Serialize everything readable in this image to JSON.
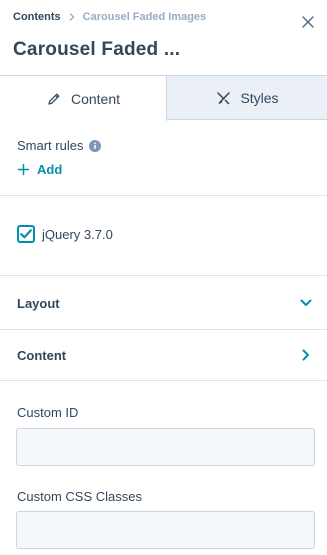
{
  "header": {
    "breadcrumb": {
      "parent": "Contents",
      "current": "Carousel Faded Images"
    },
    "title": "Carousel Faded ..."
  },
  "tabs": [
    {
      "label": "Content",
      "icon": "pencil-icon",
      "active": true
    },
    {
      "label": "Styles",
      "icon": "paint-brush-icon",
      "active": false
    }
  ],
  "smart_rules": {
    "label": "Smart rules",
    "add_label": "Add"
  },
  "dependencies": {
    "jquery": {
      "label": "jQuery 3.7.0",
      "checked": true
    }
  },
  "accordions": {
    "layout": {
      "title": "Layout",
      "icon": "chevron-down-icon"
    },
    "content": {
      "title": "Content",
      "icon": "chevron-right-icon"
    }
  },
  "fields": {
    "custom_id": {
      "label": "Custom ID",
      "value": ""
    },
    "custom_css": {
      "label": "Custom CSS Classes",
      "value": ""
    }
  },
  "colors": {
    "accent": "#0091ae",
    "text": "#33475b",
    "muted": "#99acc2",
    "border": "#cbd6e2",
    "tab_bg": "#eaf0f6"
  }
}
